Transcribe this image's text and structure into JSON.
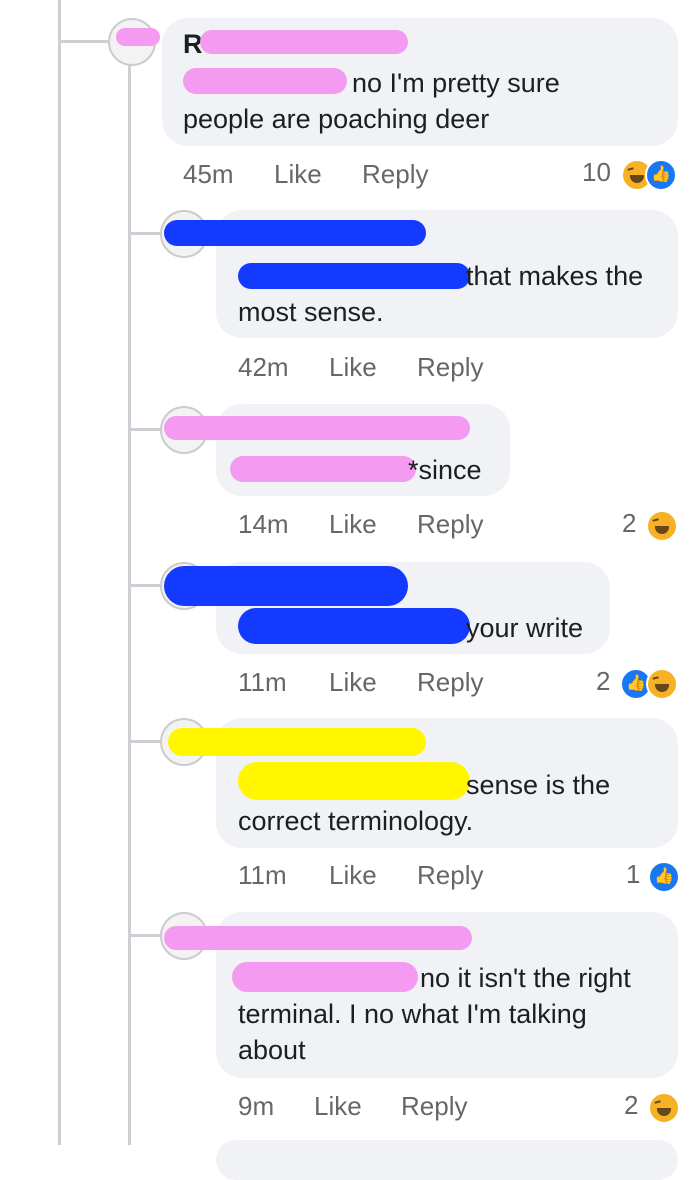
{
  "comments": [
    {
      "text_line1": "no I'm pretty sure",
      "text_line2": "people are poaching deer",
      "time": "45m",
      "like_label": "Like",
      "reply_label": "Reply",
      "reaction_count": "10",
      "reactions": [
        "haha-icon",
        "like-icon"
      ]
    },
    {
      "text_line1": "that makes the",
      "text_line2": "most sense.",
      "time": "42m",
      "like_label": "Like",
      "reply_label": "Reply"
    },
    {
      "text_line1": "*since",
      "time": "14m",
      "like_label": "Like",
      "reply_label": "Reply",
      "reaction_count": "2",
      "reactions": [
        "haha-icon"
      ]
    },
    {
      "text_line1": "your write",
      "time": "11m",
      "like_label": "Like",
      "reply_label": "Reply",
      "reaction_count": "2",
      "reactions": [
        "like-icon",
        "haha-icon"
      ]
    },
    {
      "text_line1": "sense is the",
      "text_line2": "correct terminology.",
      "time": "11m",
      "like_label": "Like",
      "reply_label": "Reply",
      "reaction_count": "1",
      "reactions": [
        "like-icon"
      ]
    },
    {
      "text_line1": "no it isn't the right",
      "text_line2": "terminal. I no what I'm talking",
      "text_line3": "about",
      "time": "9m",
      "like_label": "Like",
      "reply_label": "Reply",
      "reaction_count": "2",
      "reactions": [
        "haha-icon"
      ]
    }
  ],
  "colors": {
    "bubble": "#f0f2f5",
    "meta_text": "#65676b",
    "thread_line": "#ccd0d5",
    "redaction_pink": "#f49bf1",
    "redaction_blue": "#1439ff",
    "redaction_yellow": "#fff600",
    "like_blue": "#1877f2",
    "haha_yellow": "#f7b125"
  }
}
